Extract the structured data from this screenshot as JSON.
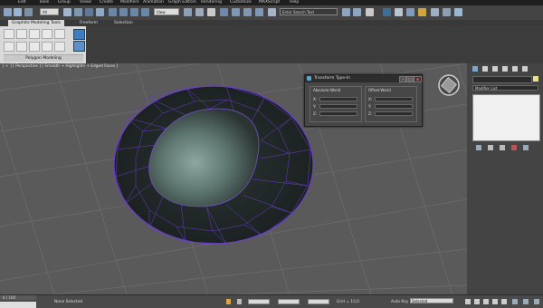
{
  "menu": {
    "items": [
      "Edit",
      "Tools",
      "Group",
      "Views",
      "Create",
      "Modifiers",
      "Animation",
      "Graph Editors",
      "Rendering",
      "Customize",
      "MAXScript",
      "Help"
    ],
    "workspace_dropdown": "Enter Search Text"
  },
  "toolbar": {
    "selection_filter": "All",
    "ref_coord": "View"
  },
  "ribbon": {
    "tabs": [
      "Graphite Modeling Tools",
      "Freeform",
      "Selection"
    ],
    "panel_title": "Polygon Modeling"
  },
  "viewport": {
    "label": "[ + ] [ Perspective ] [ Smooth + Highlights + Edged Faces ]"
  },
  "transform_dialog": {
    "title": "Transform Type-In",
    "absolute_label": "Absolute:World",
    "offset_label": "Offset:World",
    "axes": [
      "X:",
      "Y:",
      "Z:"
    ]
  },
  "command_panel": {
    "modifier_list": "Modifier List"
  },
  "timeline": {
    "frame": "0 / 100"
  },
  "statusbar": {
    "status": "None Selected",
    "grid": "Grid = 10,0",
    "autokey": "Auto Key",
    "selected": "Selected",
    "set_key": "Set Key"
  },
  "colors": {
    "viewport_bg": "#5a5a5a",
    "wire_selected": "#6a3fc8",
    "ribbon_bg": "#d9d9d9",
    "panel_bg": "#444444"
  }
}
